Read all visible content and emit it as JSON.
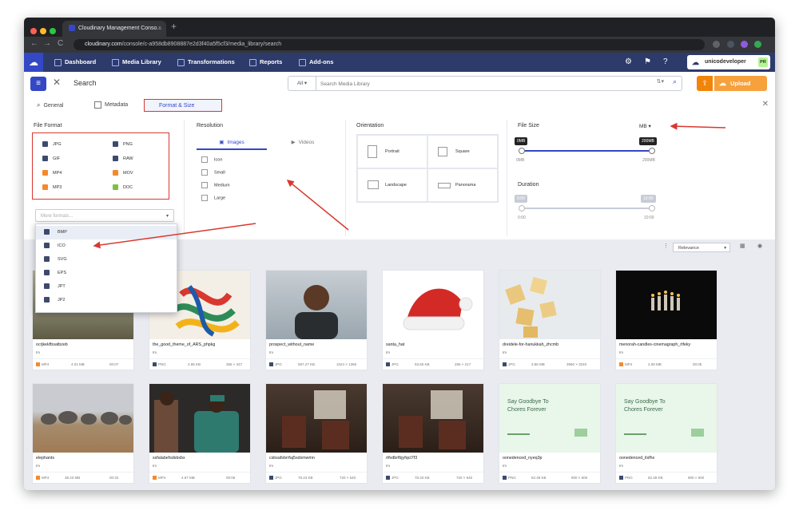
{
  "browser": {
    "tab_title": "Cloudinary Management Conso...",
    "tab_close": "×",
    "new_tab": "+",
    "url_host": "cloudinary.com",
    "url_path": "/console/c-a958db8908887e2d3f40a5f5cf3/media_library/search",
    "nav_back": "←",
    "nav_forward": "→",
    "nav_reload": "C"
  },
  "header": {
    "logo": "☁",
    "nav": [
      "Dashboard",
      "Media Library",
      "Transformations",
      "Reports",
      "Add-ons"
    ],
    "account_name": "unicodeveloper",
    "account_badge": "PR"
  },
  "search": {
    "menu_icon": "≡",
    "close_icon": "✕",
    "title": "Search",
    "scope": "All ▾",
    "placeholder": "Search Media Library",
    "sort_icon": "⇅▾",
    "search_icon": "⌕",
    "upload_label": "Upload",
    "upload_glyph": "☁",
    "upload_icon_glyph": "⇪"
  },
  "filter_tabs": {
    "general": "General",
    "metadata": "Metadata",
    "format_size": "Format & Size",
    "close": "✕"
  },
  "file_format": {
    "title": "File Format",
    "items": [
      {
        "label": "JPG",
        "color": "#3d4a6b"
      },
      {
        "label": "PNG",
        "color": "#3d4a6b"
      },
      {
        "label": "GIF",
        "color": "#3d4a6b"
      },
      {
        "label": "RAW",
        "color": "#3d4a6b"
      },
      {
        "label": "MP4",
        "color": "#f58a2c"
      },
      {
        "label": "MOV",
        "color": "#f58a2c"
      },
      {
        "label": "MP3",
        "color": "#f58a2c"
      },
      {
        "label": "DOC",
        "color": "#7bc043"
      }
    ],
    "more_placeholder": "More formats...",
    "more_chevron": "▾",
    "dropdown": [
      "BMP",
      "ICO",
      "SVG",
      "EPS",
      "JPT",
      "JP2"
    ]
  },
  "resolution": {
    "title": "Resolution",
    "tabs": [
      "Images",
      "Videos"
    ],
    "options": [
      "Icon",
      "Small",
      "Medium",
      "Large"
    ]
  },
  "orientation": {
    "title": "Orientation",
    "options": [
      "Portrait",
      "Square",
      "Landscape",
      "Panorama"
    ]
  },
  "file_size": {
    "title": "File Size",
    "unit": "MB ▾",
    "min_tip": "0MB",
    "max_tip": "200MB",
    "min_label": "0MB",
    "max_label": "200MB"
  },
  "duration": {
    "title": "Duration",
    "min_tip": "0:00",
    "max_tip": "10:00",
    "min_label": "0:00",
    "max_label": "10:00"
  },
  "toolbar": {
    "sort_label": "Relevance",
    "sort_chevron": "▾",
    "filter_icon": "⋮",
    "grid_icon": "▦",
    "view_icon": "◉"
  },
  "assets": [
    {
      "name": "ocrjkekfbsatbzeb",
      "sub": "Im",
      "type": "MP4",
      "size": "4.01 MB",
      "dim": "00:07",
      "tcolor": "#f58a2c"
    },
    {
      "name": "the_good_theme_of_ARS_phpkg",
      "sub": "Im",
      "type": "PNG",
      "size": "2.96 KB",
      "dim": "356 × 347",
      "tcolor": "#3d4a6b"
    },
    {
      "name": "prospect_without_name",
      "sub": "Im",
      "type": "JPG",
      "size": "597.27 KB",
      "dim": "1024 × 1366",
      "tcolor": "#3d4a6b"
    },
    {
      "name": "santa_hat",
      "sub": "Im",
      "type": "JPG",
      "size": "93.65 KB",
      "dim": "256 × 217",
      "tcolor": "#3d4a6b"
    },
    {
      "name": "dreidele-for-hanukkah_zhcmb",
      "sub": "Im",
      "type": "JPG",
      "size": "3.86 MB",
      "dim": "3960 × 3240",
      "tcolor": "#3d4a6b"
    },
    {
      "name": "menorah-candles-cinemagraph_rtfeky",
      "sub": "Im",
      "type": "MP4",
      "size": "2.08 MB",
      "dim": "00:05",
      "tcolor": "#f58a2c"
    },
    {
      "name": "elephants",
      "sub": "Im",
      "type": "MP4",
      "size": "38.43 MB",
      "dim": "00:32",
      "tcolor": "#f58a2c"
    },
    {
      "name": "ssfalabefsdsbxbx",
      "sub": "Im",
      "type": "MP4",
      "size": "4.67 MB",
      "dim": "00:06",
      "tcolor": "#f58a2c"
    },
    {
      "name": "csbsafsbrrfaj5sdxmwmn",
      "sub": "Im",
      "type": "JPG",
      "size": "78.23 KB",
      "dim": "720 × 540",
      "tcolor": "#3d4a6b"
    },
    {
      "name": "rtfvdbrfbjyfqct7f3",
      "sub": "Im",
      "type": "JPG",
      "size": "78.33 KB",
      "dim": "720 × 540",
      "tcolor": "#3d4a6b"
    },
    {
      "name": "oonedenced_nyeq3p",
      "sub": "Im",
      "type": "PNG",
      "size": "62.48 KB",
      "dim": "900 × 600",
      "tcolor": "#3d4a6b",
      "promo": "Say Goodbye To Chores Forever"
    },
    {
      "name": "oonedenced_ilsfhx",
      "sub": "Im",
      "type": "PNG",
      "size": "62.48 KB",
      "dim": "900 × 600",
      "tcolor": "#3d4a6b",
      "promo": "Say Goodbye To Chores Forever"
    }
  ]
}
